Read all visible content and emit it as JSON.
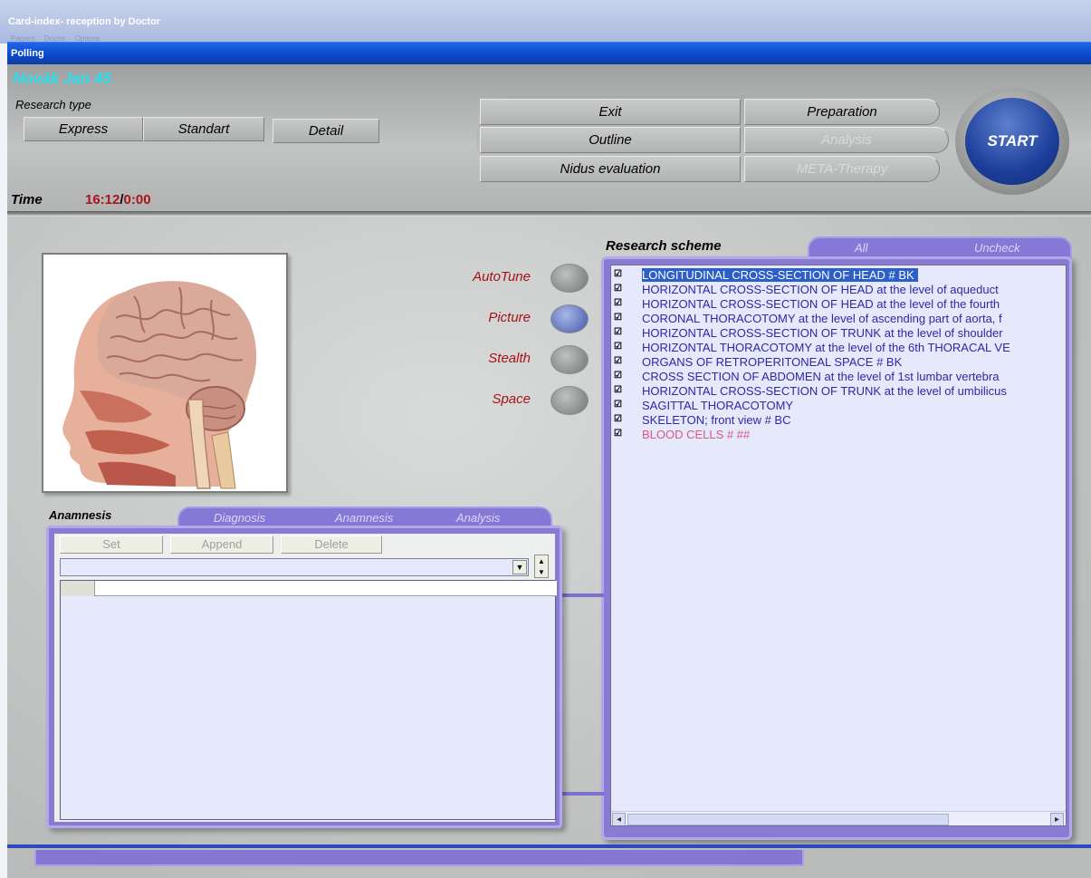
{
  "window": {
    "title": "Card-index- reception by Doctor",
    "menu": [
      "Pacient",
      "Doctor",
      "Options"
    ]
  },
  "dialog": {
    "title": "Polling"
  },
  "patient": {
    "name": "Novák Jan  45"
  },
  "research_type": {
    "label": "Research type",
    "options": [
      "Express",
      "Standart",
      "Detail"
    ]
  },
  "actions": {
    "exit": "Exit",
    "outline": "Outline",
    "nidus": "Nidus evaluation",
    "preparation": "Preparation",
    "analysis": "Analysis",
    "meta": "META-Therapy",
    "start": "START"
  },
  "time": {
    "label": "Time",
    "clock": "16:12",
    "separator": "/",
    "elapsed": "0:00"
  },
  "modes": [
    {
      "label": "AutoTune",
      "active": false
    },
    {
      "label": "Picture",
      "active": true
    },
    {
      "label": "Stealth",
      "active": false
    },
    {
      "label": "Space",
      "active": false
    }
  ],
  "scheme": {
    "label": "Research scheme",
    "tabs": {
      "all": "All",
      "uncheck": "Uncheck"
    },
    "items": [
      {
        "text": "LONGITUDINAL CROSS-SECTION OF HEAD # BK",
        "checked": true,
        "selected": true
      },
      {
        "text": "HORIZONTAL CROSS-SECTION OF HEAD at the level of aqueduct",
        "checked": true
      },
      {
        "text": "HORIZONTAL CROSS-SECTION OF HEAD at the level of the fourth",
        "checked": true
      },
      {
        "text": "CORONAL THORACOTOMY at the level of ascending part of aorta, f",
        "checked": true
      },
      {
        "text": "HORIZONTAL CROSS-SECTION OF TRUNK at the level of shoulder",
        "checked": true
      },
      {
        "text": "HORIZONTAL THORACOTOMY at the level of the 6th THORACAL VE",
        "checked": true
      },
      {
        "text": "ORGANS OF RETROPERITONEAL SPACE # BK",
        "checked": true
      },
      {
        "text": "CROSS SECTION OF ABDOMEN at the level of 1st lumbar vertebra",
        "checked": true
      },
      {
        "text": "HORIZONTAL CROSS-SECTION OF TRUNK at the level of umbilicus",
        "checked": true
      },
      {
        "text": "SAGITTAL THORACOTOMY",
        "checked": true
      },
      {
        "text": "SKELETON;  front view # BC",
        "checked": true
      },
      {
        "text": "BLOOD  CELLS # ##",
        "checked": true,
        "highlight": "red"
      }
    ]
  },
  "anamnesis": {
    "label": "Anamnesis",
    "tabs": [
      "Diagnosis",
      "Anamnesis",
      "Analysis"
    ],
    "buttons": {
      "set": "Set",
      "append": "Append",
      "delete": "Delete"
    }
  },
  "colors": {
    "accent": "#8678d6",
    "name": "#27e0f0",
    "label_red": "#a31319",
    "list_text": "#2b2aa8",
    "start_blue": "#1d3f9b"
  },
  "icons": [
    "checkbox-checked-icon",
    "dropdown-arrow-icon",
    "spin-up-icon",
    "spin-down-icon",
    "scroll-left-icon",
    "scroll-right-icon"
  ]
}
